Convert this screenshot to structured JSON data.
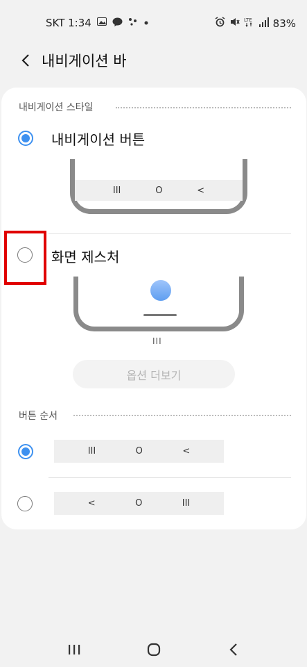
{
  "status_bar": {
    "carrier_time": "SKT 1:34",
    "battery": "83%",
    "icons_left": [
      "image-icon",
      "talk-icon",
      "assistant-icon",
      "dot-icon"
    ],
    "icons_right": [
      "alarm-icon",
      "mute-icon",
      "lte-icon",
      "signal-icon"
    ]
  },
  "header": {
    "title": "내비게이션 바"
  },
  "style_section": {
    "title": "내비게이션 스타일",
    "options": [
      {
        "label": "내비게이션 버튼",
        "selected": true,
        "buttons": [
          "III",
          "O",
          "<"
        ]
      },
      {
        "label": "화면 제스처",
        "selected": false
      }
    ],
    "gesture_caption": "III",
    "more_options": "옵션 더보기"
  },
  "order_section": {
    "title": "버튼 순서",
    "options": [
      {
        "selected": true,
        "buttons": [
          "III",
          "O",
          "<"
        ]
      },
      {
        "selected": false,
        "buttons": [
          "<",
          "O",
          "III"
        ]
      }
    ]
  },
  "bottom_nav": {
    "recents": "III",
    "home": "O",
    "back": "<"
  },
  "colors": {
    "accent": "#3e91f0",
    "highlight": "#e00000",
    "background": "#f2f2f2"
  }
}
